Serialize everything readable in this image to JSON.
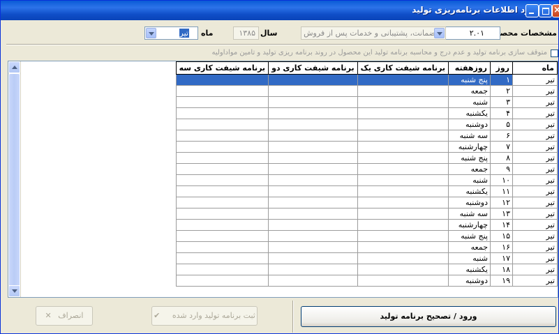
{
  "window": {
    "title": "ورود اطلاعات برنامه‌ریزی تولید"
  },
  "filters": {
    "product_label": "مشخصات محصول",
    "product_code": "۲.۰۱",
    "product_desc": "ضمانت، پشتیبانی و خدمات پس از فروش",
    "year_label": "سال",
    "year_value": "۱۳۸۵",
    "month_label": "ماه",
    "month_value": "تیر"
  },
  "option": {
    "stop_label": "متوقف سازی برنامه تولید و عدم درج و محاسبه برنامه تولید این محصول در روند برنامه ریزی تولید و تامین مواداولیه"
  },
  "grid": {
    "headers": [
      "ماه",
      "روز",
      "روزهفته",
      "برنامه شیفت کاری یک",
      "برنامه شیفت کاری دو",
      "برنامه شیفت کاری سه"
    ],
    "rows": [
      {
        "month": "تیر",
        "day": "۱",
        "weekday": "پنج شنبه"
      },
      {
        "month": "تیر",
        "day": "۲",
        "weekday": "جمعه"
      },
      {
        "month": "تیر",
        "day": "۳",
        "weekday": "شنبه"
      },
      {
        "month": "تیر",
        "day": "۴",
        "weekday": "یکشنبه"
      },
      {
        "month": "تیر",
        "day": "۵",
        "weekday": "دوشنبه"
      },
      {
        "month": "تیر",
        "day": "۶",
        "weekday": "سه شنبه"
      },
      {
        "month": "تیر",
        "day": "۷",
        "weekday": "چهارشنبه"
      },
      {
        "month": "تیر",
        "day": "۸",
        "weekday": "پنج شنبه"
      },
      {
        "month": "تیر",
        "day": "۹",
        "weekday": "جمعه"
      },
      {
        "month": "تیر",
        "day": "۱۰",
        "weekday": "شنبه"
      },
      {
        "month": "تیر",
        "day": "۱۱",
        "weekday": "یکشنبه"
      },
      {
        "month": "تیر",
        "day": "۱۲",
        "weekday": "دوشنبه"
      },
      {
        "month": "تیر",
        "day": "۱۳",
        "weekday": "سه شنبه"
      },
      {
        "month": "تیر",
        "day": "۱۴",
        "weekday": "چهارشنبه"
      },
      {
        "month": "تیر",
        "day": "۱۵",
        "weekday": "پنج شنبه"
      },
      {
        "month": "تیر",
        "day": "۱۶",
        "weekday": "جمعه"
      },
      {
        "month": "تیر",
        "day": "۱۷",
        "weekday": "شنبه"
      },
      {
        "month": "تیر",
        "day": "۱۸",
        "weekday": "یکشنبه"
      },
      {
        "month": "تیر",
        "day": "۱۹",
        "weekday": "دوشنبه"
      }
    ]
  },
  "buttons": {
    "enter_edit": "ورود / تصحیح برنامه تولید",
    "save": "ثبت برنامه تولید وارد شده",
    "cancel": "انصراف"
  }
}
